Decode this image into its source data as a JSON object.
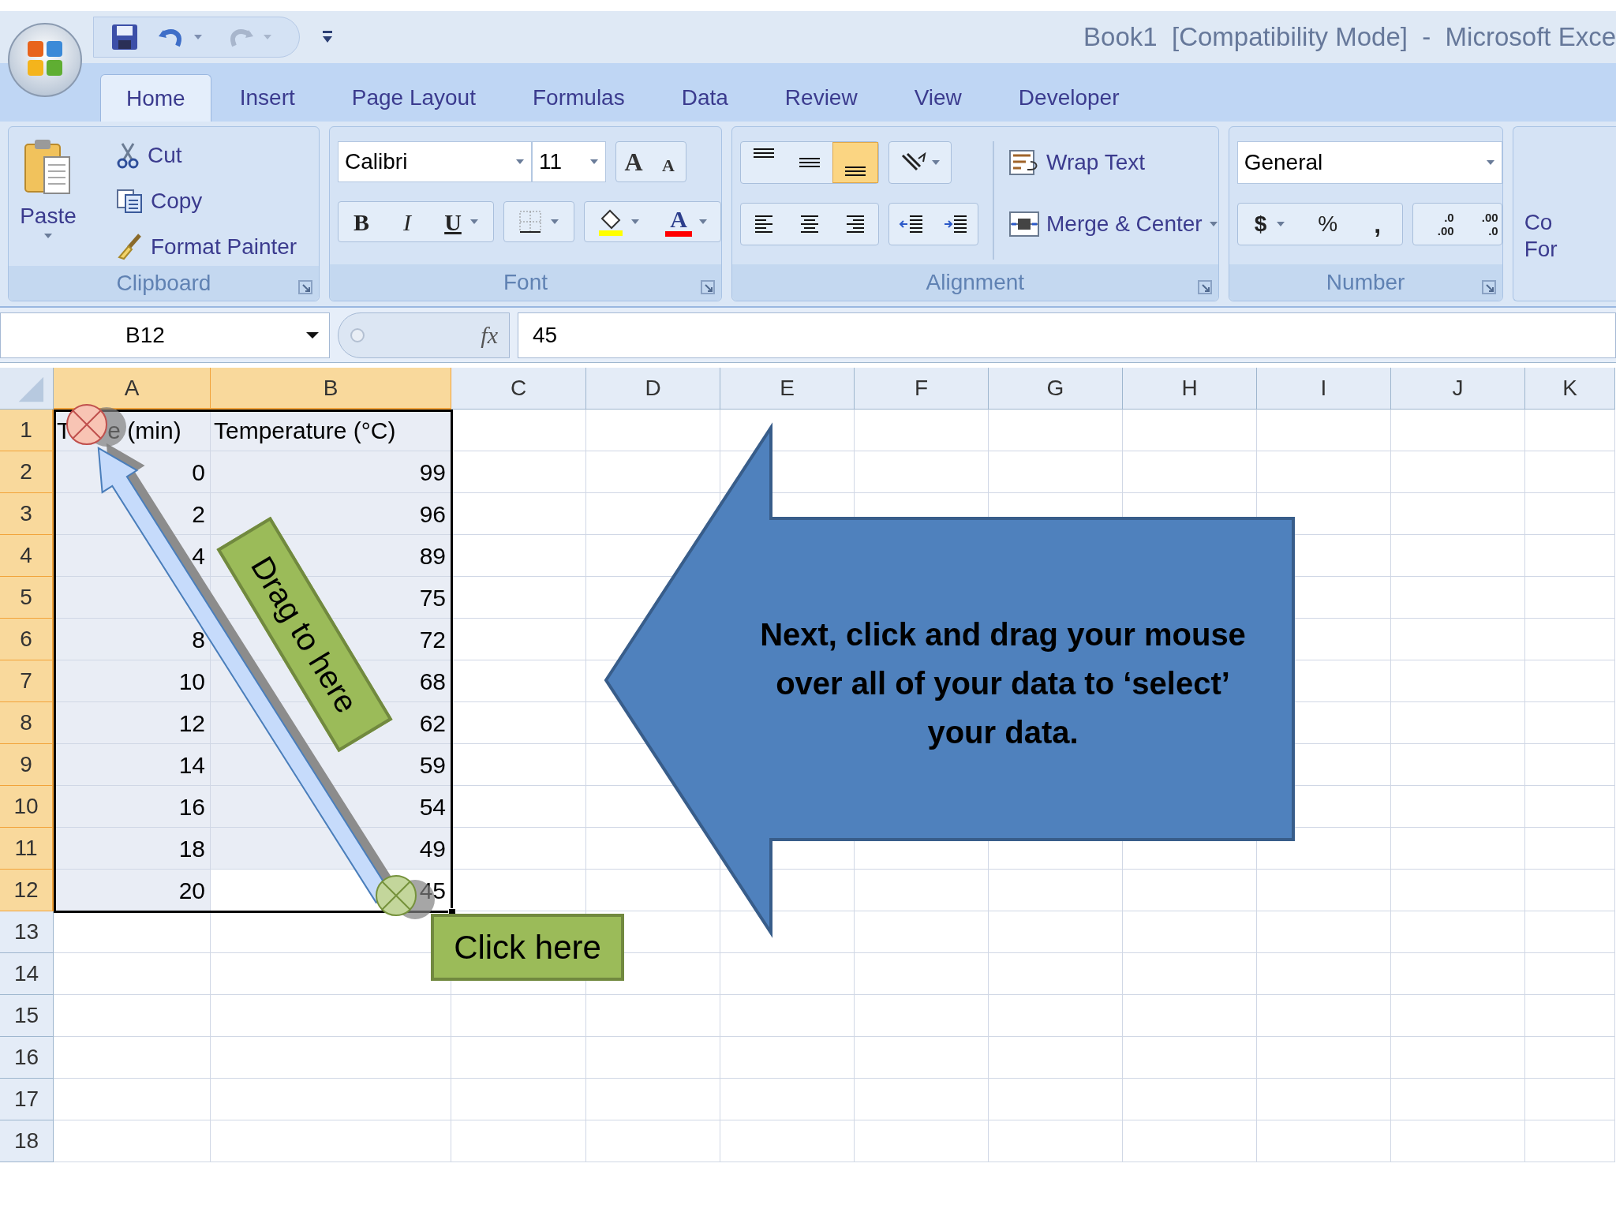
{
  "window": {
    "title": "Book1  [Compatibility Mode]  -  Microsoft Exce"
  },
  "tabs": [
    {
      "label": "Home",
      "selected": true
    },
    {
      "label": "Insert",
      "selected": false
    },
    {
      "label": "Page Layout",
      "selected": false
    },
    {
      "label": "Formulas",
      "selected": false
    },
    {
      "label": "Data",
      "selected": false
    },
    {
      "label": "Review",
      "selected": false
    },
    {
      "label": "View",
      "selected": false
    },
    {
      "label": "Developer",
      "selected": false
    }
  ],
  "clipboard": {
    "label": "Clipboard",
    "paste": "Paste",
    "cut": "Cut",
    "copy": "Copy",
    "format_painter": "Format Painter"
  },
  "font": {
    "label": "Font",
    "name": "Calibri",
    "size": "11",
    "grow": "A",
    "shrink": "A",
    "bold": "B",
    "italic": "I",
    "underline": "U",
    "font_color": "A"
  },
  "alignment": {
    "label": "Alignment",
    "vertical": [
      {
        "selected": false
      },
      {
        "selected": false
      },
      {
        "selected": true
      }
    ],
    "wrap_text": "Wrap Text",
    "merge": "Merge & Center"
  },
  "number": {
    "label": "Number",
    "format": "General",
    "currency": "$",
    "percent": "%",
    "comma": ",",
    "increase_decimal": [
      ".0",
      ".00"
    ],
    "decrease_decimal": [
      ".00",
      ".0"
    ]
  },
  "next_group": {
    "lines": [
      "Co",
      "For"
    ]
  },
  "formula_bar": {
    "name_box": "B12",
    "fx": "fx",
    "value": "45"
  },
  "sheet": {
    "columns": [
      {
        "label": "A",
        "selected": true
      },
      {
        "label": "B",
        "selected": true
      },
      {
        "label": "C",
        "selected": false
      },
      {
        "label": "D",
        "selected": false
      },
      {
        "label": "E",
        "selected": false
      },
      {
        "label": "F",
        "selected": false
      },
      {
        "label": "G",
        "selected": false
      },
      {
        "label": "H",
        "selected": false
      },
      {
        "label": "I",
        "selected": false
      },
      {
        "label": "J",
        "selected": false
      },
      {
        "label": "K",
        "selected": false
      }
    ],
    "rows": [
      {
        "label": "1",
        "selected": true,
        "cells": [
          {
            "kind": "text",
            "parts": [
              "T",
              "e (min)"
            ],
            "selected": true,
            "active": false
          },
          {
            "kind": "text",
            "text": "Temperature (°C)",
            "selected": true,
            "active": false
          }
        ]
      },
      {
        "label": "2",
        "selected": true,
        "cells": [
          {
            "kind": "number",
            "text": "0",
            "selected": true,
            "active": false
          },
          {
            "kind": "number",
            "text": "99",
            "selected": true,
            "active": false
          }
        ]
      },
      {
        "label": "3",
        "selected": true,
        "cells": [
          {
            "kind": "number",
            "text": "2",
            "selected": true,
            "active": false
          },
          {
            "kind": "number",
            "text": "96",
            "selected": true,
            "active": false
          }
        ]
      },
      {
        "label": "4",
        "selected": true,
        "cells": [
          {
            "kind": "number",
            "text": "4",
            "selected": true,
            "active": false
          },
          {
            "kind": "number",
            "text": "89",
            "selected": true,
            "active": false
          }
        ]
      },
      {
        "label": "5",
        "selected": true,
        "cells": [
          {
            "kind": "number",
            "selected": true,
            "active": false
          },
          {
            "kind": "number",
            "text": "75",
            "selected": true,
            "active": false
          }
        ]
      },
      {
        "label": "6",
        "selected": true,
        "cells": [
          {
            "kind": "number",
            "text": "8",
            "selected": true,
            "active": false
          },
          {
            "kind": "number",
            "text": "72",
            "selected": true,
            "active": false
          }
        ]
      },
      {
        "label": "7",
        "selected": true,
        "cells": [
          {
            "kind": "number",
            "text": "10",
            "selected": true,
            "active": false
          },
          {
            "kind": "number",
            "text": "68",
            "selected": true,
            "active": false
          }
        ]
      },
      {
        "label": "8",
        "selected": true,
        "cells": [
          {
            "kind": "number",
            "text": "12",
            "selected": true,
            "active": false
          },
          {
            "kind": "number",
            "text": "62",
            "selected": true,
            "active": false
          }
        ]
      },
      {
        "label": "9",
        "selected": true,
        "cells": [
          {
            "kind": "number",
            "text": "14",
            "selected": true,
            "active": false
          },
          {
            "kind": "number",
            "text": "59",
            "selected": true,
            "active": false
          }
        ]
      },
      {
        "label": "10",
        "selected": true,
        "cells": [
          {
            "kind": "number",
            "text": "16",
            "selected": true,
            "active": false
          },
          {
            "kind": "number",
            "text": "54",
            "selected": true,
            "active": false
          }
        ]
      },
      {
        "label": "11",
        "selected": true,
        "cells": [
          {
            "kind": "number",
            "text": "18",
            "selected": true,
            "active": false
          },
          {
            "kind": "number",
            "text": "49",
            "selected": true,
            "active": false
          }
        ]
      },
      {
        "label": "12",
        "selected": true,
        "cells": [
          {
            "kind": "number",
            "text": "20",
            "selected": true,
            "active": false
          },
          {
            "kind": "number",
            "text": "45",
            "selected": true,
            "active": true
          }
        ]
      },
      {
        "label": "13",
        "selected": false
      },
      {
        "label": "14",
        "selected": false
      },
      {
        "label": "15",
        "selected": false
      },
      {
        "label": "16",
        "selected": false
      },
      {
        "label": "17",
        "selected": false
      },
      {
        "label": "18",
        "selected": false
      }
    ]
  },
  "callout": {
    "text": "Next, click and drag your mouse over all of your data to ‘select’ your data."
  },
  "drag_label": "Drag to here",
  "click_label": "Click here"
}
